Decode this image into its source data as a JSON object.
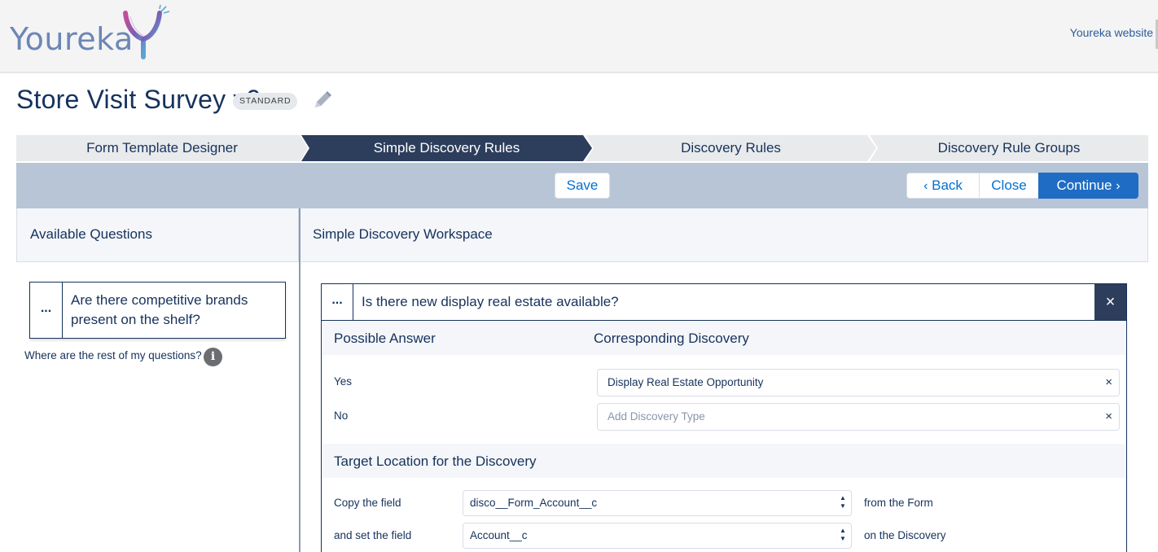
{
  "header": {
    "logo_text": "Youreka",
    "site_link": "Youreka website"
  },
  "page": {
    "title": "Store Visit Survey v9",
    "badge": "STANDARD"
  },
  "path": {
    "steps": [
      {
        "label": "Form Template Designer",
        "state": "inactive"
      },
      {
        "label": "Simple Discovery Rules",
        "state": "active"
      },
      {
        "label": "Discovery Rules",
        "state": "inactive"
      },
      {
        "label": "Discovery Rule Groups",
        "state": "inactive"
      }
    ]
  },
  "toolbar": {
    "save_label": "Save",
    "back_label": "Back",
    "close_label": "Close",
    "continue_label": "Continue"
  },
  "left_panel": {
    "title": "Available Questions",
    "question_menu": "...",
    "question": "Are there competitive brands present on the shelf?",
    "help_text": "Where are the rest of my questions?"
  },
  "workspace": {
    "title": "Simple Discovery Workspace",
    "rule": {
      "menu": "...",
      "question": "Is there new display real estate available?",
      "close_symbol": "×",
      "col_answer": "Possible Answer",
      "col_discovery": "Corresponding Discovery",
      "answers": [
        {
          "label": "Yes",
          "value": "Display Real Estate Opportunity",
          "placeholder": ""
        },
        {
          "label": "No",
          "value": "",
          "placeholder": "Add Discovery Type"
        }
      ],
      "clear_symbol": "×",
      "target_title": "Target Location for the Discovery",
      "mappings": [
        {
          "label": "Copy the field",
          "value": "disco__Form_Account__c",
          "after": "from the Form"
        },
        {
          "label": "and set the field",
          "value": "Account__c",
          "after": "on the Discovery"
        }
      ]
    }
  },
  "colors": {
    "navy": "#16325c",
    "active_step": "#2d3e5c",
    "toolbar_bg": "#b8c5d6",
    "brand_blue": "#1f6cc4",
    "link": "#0070d2"
  },
  "icons": [
    "pencil-icon",
    "info-icon",
    "chevron-left-icon",
    "chevron-right-icon",
    "close-icon",
    "ellipsis-icon",
    "select-arrows-icon"
  ]
}
